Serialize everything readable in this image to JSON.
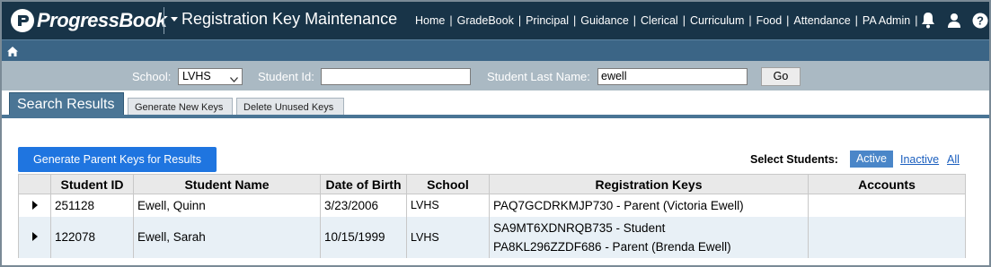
{
  "header": {
    "brand": "ProgressBook",
    "app_title": "Registration Key Maintenance",
    "nav": [
      {
        "label": "Home"
      },
      {
        "label": "GradeBook"
      },
      {
        "label": "Principal"
      },
      {
        "label": "Guidance"
      },
      {
        "label": "Clerical"
      },
      {
        "label": "Curriculum"
      },
      {
        "label": "Food"
      },
      {
        "label": "Attendance"
      },
      {
        "label": "PA Admin"
      }
    ],
    "icons": [
      "bell-icon",
      "user-icon",
      "help-icon"
    ]
  },
  "breadcrumb": {
    "icon": "home-icon"
  },
  "search": {
    "school_label": "School:",
    "school_value": "LVHS",
    "student_id_label": "Student Id:",
    "student_id_value": "",
    "last_name_label": "Student Last Name:",
    "last_name_value": "ewell",
    "go_label": "Go"
  },
  "tabs": [
    {
      "label": "Search Results",
      "active": true
    },
    {
      "label": "Generate New Keys",
      "active": false
    },
    {
      "label": "Delete Unused Keys",
      "active": false
    }
  ],
  "actions": {
    "generate_parent_keys_label": "Generate Parent Keys for Results",
    "select_students_label": "Select Students:",
    "filters": [
      "Active",
      "Inactive",
      "All"
    ],
    "active_filter": "Active"
  },
  "table": {
    "columns": [
      "",
      "Student ID",
      "Student Name",
      "Date of Birth",
      "School",
      "Registration Keys",
      "Accounts"
    ],
    "rows": [
      {
        "student_id": "251128",
        "student_name": "Ewell, Quinn",
        "dob": "3/23/2006",
        "school": "LVHS",
        "keys": [
          "PAQ7GCDRKMJP730 - Parent (Victoria Ewell)"
        ],
        "accounts": ""
      },
      {
        "student_id": "122078",
        "student_name": "Ewell, Sarah",
        "dob": "10/15/1999",
        "school": "LVHS",
        "keys": [
          "SA9MT6XDNRQB735 - Student",
          "PA8KL296ZZDF686 - Parent (Brenda Ewell)"
        ],
        "accounts": ""
      }
    ]
  },
  "colors": {
    "header_bg": "#183448",
    "subheader_bg": "#3b6586",
    "searchbar_bg": "#aab9c3",
    "tab_active_bg": "#4a7595",
    "primary_button": "#1f75e0",
    "filter_active_bg": "#4a86c8",
    "alt_row_bg": "#e8f0f6"
  }
}
